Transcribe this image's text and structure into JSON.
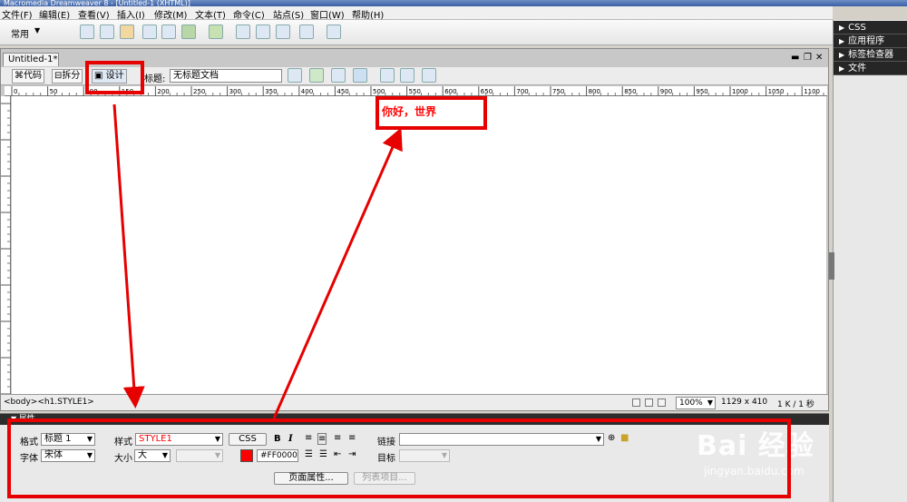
{
  "window": {
    "title": "Macromedia Dreamweaver 8 - [Untitled-1 (XHTML)]"
  },
  "menu": [
    "文件(F)",
    "编辑(E)",
    "查看(V)",
    "插入(I)",
    "修改(M)",
    "文本(T)",
    "命令(C)",
    "站点(S)",
    "窗口(W)",
    "帮助(H)"
  ],
  "toolbar": {
    "category": "常用"
  },
  "right_panels": [
    "CSS",
    "应用程序",
    "标签检查器",
    "文件"
  ],
  "doc": {
    "tab": "Untitled-1*",
    "views": {
      "code": "代码",
      "split": "拆分",
      "design": "设计"
    },
    "title_label": "标题:",
    "title_value": "无标题文档"
  },
  "ruler": {
    "ticks": [
      "0",
      "50",
      "100",
      "150",
      "200",
      "250",
      "300",
      "350",
      "400",
      "450",
      "500",
      "550",
      "600",
      "650",
      "700",
      "750",
      "800",
      "850",
      "900",
      "950",
      "1000",
      "1050",
      "1100"
    ]
  },
  "canvas": {
    "heading": "你好，世界",
    "heading_color": "#FF0000"
  },
  "status": {
    "tags": "<body><h1.STYLE1>",
    "zoom": "100%",
    "size": "1129 x 410",
    "filesize": "1 K / 1 秒"
  },
  "props": {
    "title": "属性",
    "format_label": "格式",
    "format_value": "标题 1",
    "style_label": "样式",
    "style_value": "STYLE1",
    "css_btn": "CSS",
    "font_label": "字体",
    "font_value": "宋体",
    "size_label": "大小",
    "size_value": "大",
    "color_value": "#FF0000",
    "link_label": "链接",
    "target_label": "目标",
    "page_props_btn": "页面属性...",
    "list_item_btn": "列表项目..."
  },
  "watermark": {
    "brand": "Bai 经验",
    "url": "jingyan.baidu.com"
  },
  "annotation_color": "#E60000"
}
